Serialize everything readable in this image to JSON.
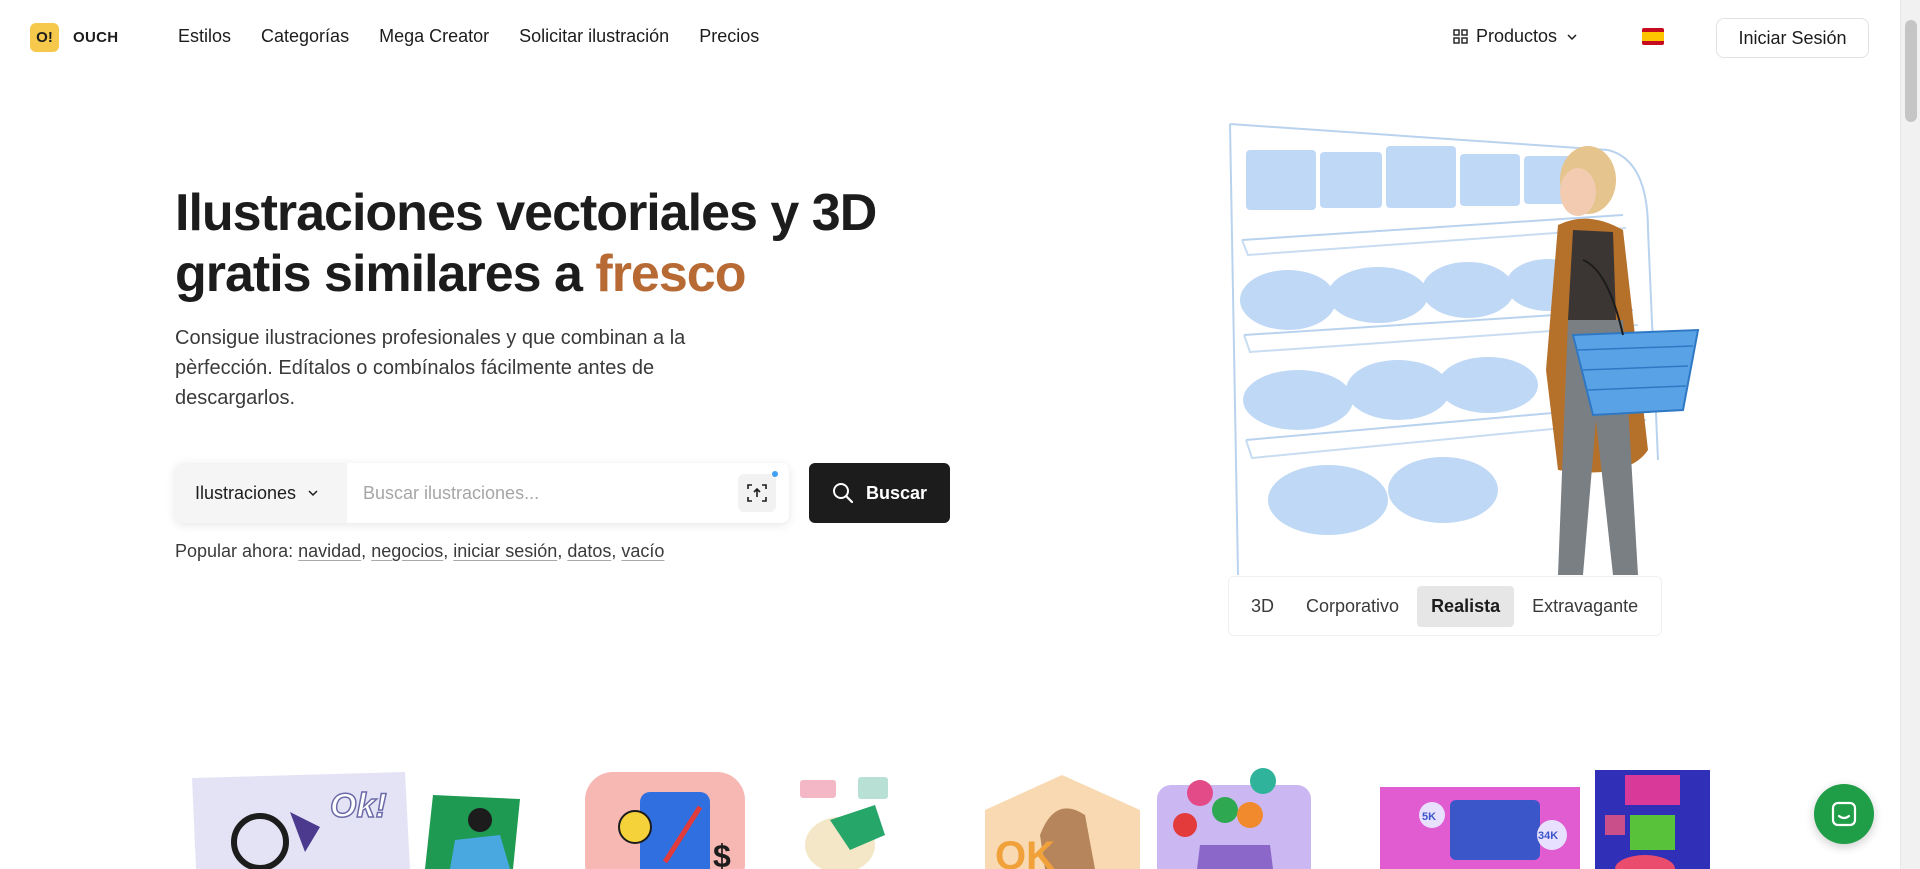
{
  "brand": {
    "logo_mark": "O!",
    "name": "OUCH"
  },
  "nav": {
    "items": [
      {
        "label": "Estilos"
      },
      {
        "label": "Categorías"
      },
      {
        "label": "Mega Creator"
      },
      {
        "label": "Solicitar ilustración"
      },
      {
        "label": "Precios"
      }
    ],
    "products_label": "Productos",
    "login_label": "Iniciar Sesión",
    "language_flag": "spain-flag-icon"
  },
  "hero": {
    "title_main": "Ilustraciones vectoriales y 3D gratis similares a",
    "title_accent": "fresco",
    "subtitle": "Consigue ilustraciones profesionales y que combinan a la pèrfección. Edítalos o combínalos fácilmente antes de descargarlos."
  },
  "search": {
    "type_label": "Ilustraciones",
    "placeholder": "Buscar ilustraciones...",
    "button_label": "Buscar"
  },
  "popular": {
    "label": "Popular ahora:",
    "tags": [
      {
        "label": "navidad",
        "sep": ", "
      },
      {
        "label": "negocios",
        "sep": ", "
      },
      {
        "label": "iniciar sesión",
        "sep": ", "
      },
      {
        "label": "datos",
        "sep": ", "
      },
      {
        "label": "vacío",
        "sep": ""
      }
    ]
  },
  "style_tabs": [
    {
      "label": "3D",
      "active": false
    },
    {
      "label": "Corporativo",
      "active": false
    },
    {
      "label": "Realista",
      "active": true
    },
    {
      "label": "Extravagante",
      "active": false
    }
  ],
  "thumbnail_icons": [
    "ok-search-illustration",
    "person-on-green-card",
    "finance-phone-illustration",
    "collaboration-illustration",
    "3d-hand-illustration",
    "balloons-gift-box",
    "social-stats-illustration",
    "3d-blocks-illustration"
  ],
  "colors": {
    "accent": "#b86a35",
    "logo_bg": "#f6c94d",
    "dark_button": "#1c1c1c",
    "chat": "#1f9e47"
  }
}
